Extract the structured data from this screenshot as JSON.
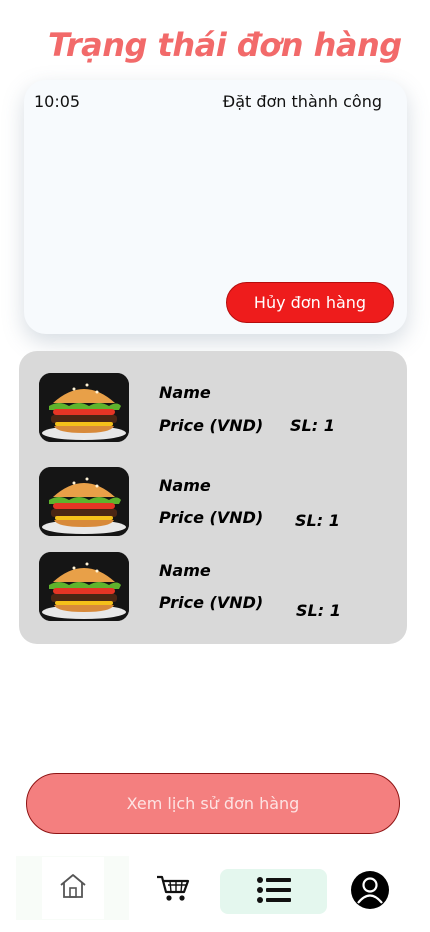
{
  "page": {
    "title": "Trạng thái đơn hàng"
  },
  "status_card": {
    "time": "10:05",
    "message": "Đặt đơn thành công",
    "cancel_label": "Hủy đơn hàng"
  },
  "order_items": [
    {
      "name": "Name",
      "price": "Price (VND)",
      "qty": "SL: 1",
      "image": "burger-image"
    },
    {
      "name": "Name",
      "price": "Price (VND)",
      "qty": "SL: 1",
      "image": "burger-image"
    },
    {
      "name": "Name",
      "price": "Price (VND)",
      "qty": "SL: 1",
      "image": "burger-image"
    }
  ],
  "history_button": {
    "label": "Xem lịch sử đơn hàng"
  },
  "bottom_nav": {
    "items": [
      {
        "icon": "home-icon",
        "active": false
      },
      {
        "icon": "cart-icon",
        "active": false
      },
      {
        "icon": "list-icon",
        "active": true
      },
      {
        "icon": "user-icon",
        "active": false
      }
    ]
  },
  "colors": {
    "title": "#f26a6a",
    "cancel_button": "#ee1c1c",
    "history_button": "#f47f7f",
    "panel": "#d9d9d9",
    "nav_active": "#e4f7ee"
  }
}
